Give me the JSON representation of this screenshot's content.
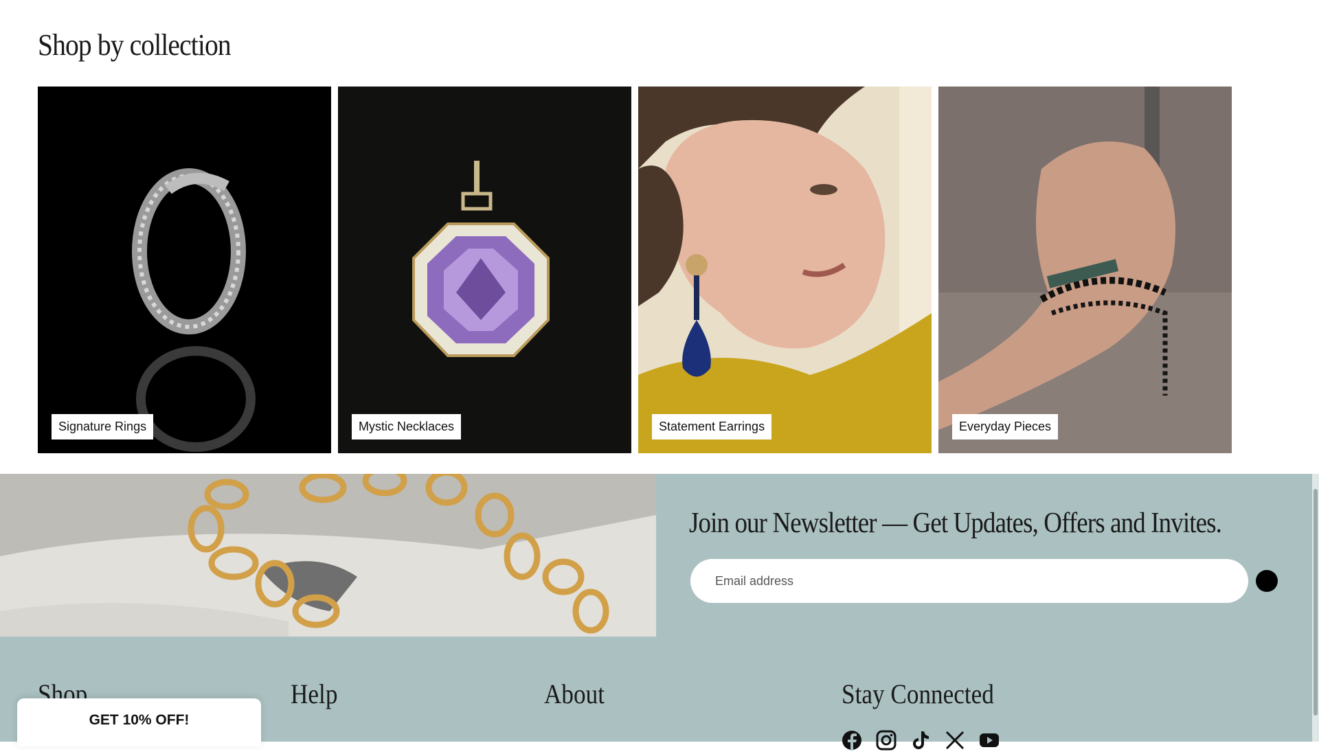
{
  "collections": {
    "title": "Shop by collection",
    "items": [
      {
        "label": "Signature Rings"
      },
      {
        "label": "Mystic Necklaces"
      },
      {
        "label": "Statement Earrings"
      },
      {
        "label": "Everyday Pieces"
      }
    ]
  },
  "newsletter": {
    "heading": "Join our Newsletter — Get Updates, Offers and Invites.",
    "email_placeholder": "Email address"
  },
  "footer": {
    "columns": [
      "Shop",
      "Help",
      "About",
      "Stay Connected"
    ],
    "social_icons": [
      "facebook-icon",
      "instagram-icon",
      "tiktok-icon",
      "x-icon",
      "youtube-icon"
    ]
  },
  "promo": {
    "label": "GET 10% OFF!"
  },
  "colors": {
    "band": "#abc1c1",
    "text": "#1a1a1a"
  }
}
